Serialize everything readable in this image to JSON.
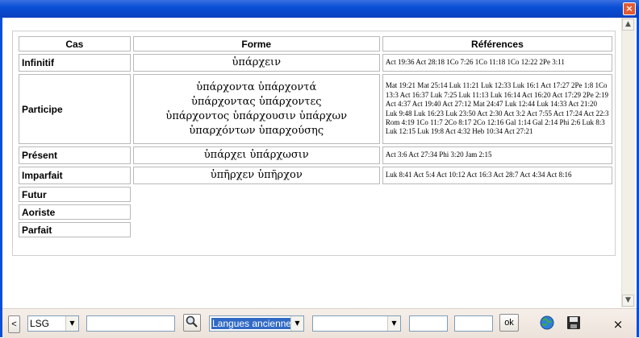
{
  "window": {
    "close_glyph": "×"
  },
  "table": {
    "headers": {
      "cas": "Cas",
      "forme": "Forme",
      "refs": "Références"
    },
    "rows": [
      {
        "cas": "Infinitif",
        "forme": [
          "ὑπάρχειν"
        ],
        "refs": "Act 19:36 Act 28:18 1Co 7:26 1Co 11:18 1Co 12:22 2Pe 3:11"
      },
      {
        "cas": "Participe",
        "forme": [
          "ὑπάρχοντα ὑπάρχοντά",
          "ὑπάρχοντας ὑπάρχοντες",
          "ὑπάρχοντος ὑπάρχουσιν ὑπάρχων",
          "ὑπαρχόντων ὑπαρχούσης"
        ],
        "refs": "Mat 19:21 Mat 25:14 Luk 11:21 Luk 12:33 Luk 16:1 Act 17:27 2Pe 1:8 1Co 13:3 Act 16:37 Luk 7:25 Luk 11:13 Luk 16:14 Act 16:20 Act 17:29 2Pe 2:19 Act 4:37 Act 19:40 Act 27:12 Mat 24:47 Luk 12:44 Luk 14:33 Act 21:20 Luk 9:48 Luk 16:23 Luk 23:50 Act 2:30 Act 3:2 Act 7:55 Act 17:24 Act 22:3 Rom 4:19 1Co 11:7 2Co 8:17 2Co 12:16 Gal 1:14 Gal 2:14 Phi 2:6 Luk 8:3 Luk 12:15 Luk 19:8 Act 4:32 Heb 10:34 Act 27:21"
      },
      {
        "cas": "Présent",
        "forme": [
          "ὑπάρχει ὑπάρχωσιν"
        ],
        "refs": "Act 3:6 Act 27:34 Phi 3:20 Jam 2:15"
      },
      {
        "cas": "Imparfait",
        "forme": [
          "ὑπῆρχεν ὑπῆρχον"
        ],
        "refs": "Luk 8:41 Act 5:4 Act 10:12 Act 16:3 Act 28:7 Act 4:34 Act 8:16"
      },
      {
        "cas": "Futur"
      },
      {
        "cas": "Aoriste"
      },
      {
        "cas": "Parfait"
      }
    ]
  },
  "toolbar": {
    "prev_glyph": "<",
    "version_value": "LSG",
    "search_value": "",
    "language_value": "Langues anciennes",
    "combo2_value": "",
    "field_a": "",
    "field_b": "",
    "ok_label": "ok",
    "close_glyph": "×"
  }
}
